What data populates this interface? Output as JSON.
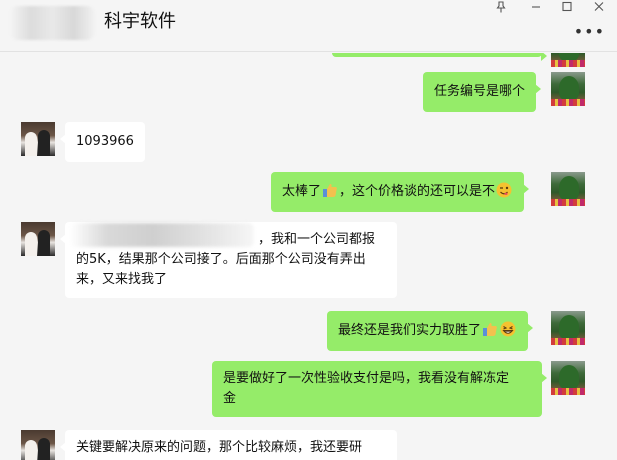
{
  "header": {
    "title": "科宇软件"
  },
  "messages": [
    {
      "side": "me",
      "text": "任务编号是哪个"
    },
    {
      "side": "other",
      "text": "1093966"
    },
    {
      "side": "me",
      "text_before": "太棒了",
      "text_after": "，这个价格谈的还可以是不"
    },
    {
      "side": "other",
      "line1": "，我和一个公司都报",
      "line2": "的5K，结果那个公司接了。后面那个公司没有弄出",
      "line3": "来，又来找我了"
    },
    {
      "side": "me",
      "text": "最终还是我们实力取胜了"
    },
    {
      "side": "me",
      "line1": "是要做好了一次性验收支付是吗，我看没有解冻定",
      "line2": "金"
    },
    {
      "side": "other",
      "text": "关键要解决原来的问题，那个比较麻烦，我还要研"
    }
  ],
  "colors": {
    "my_bubble": "#95ec69",
    "other_bubble": "#ffffff",
    "background": "#f5f5f5"
  }
}
